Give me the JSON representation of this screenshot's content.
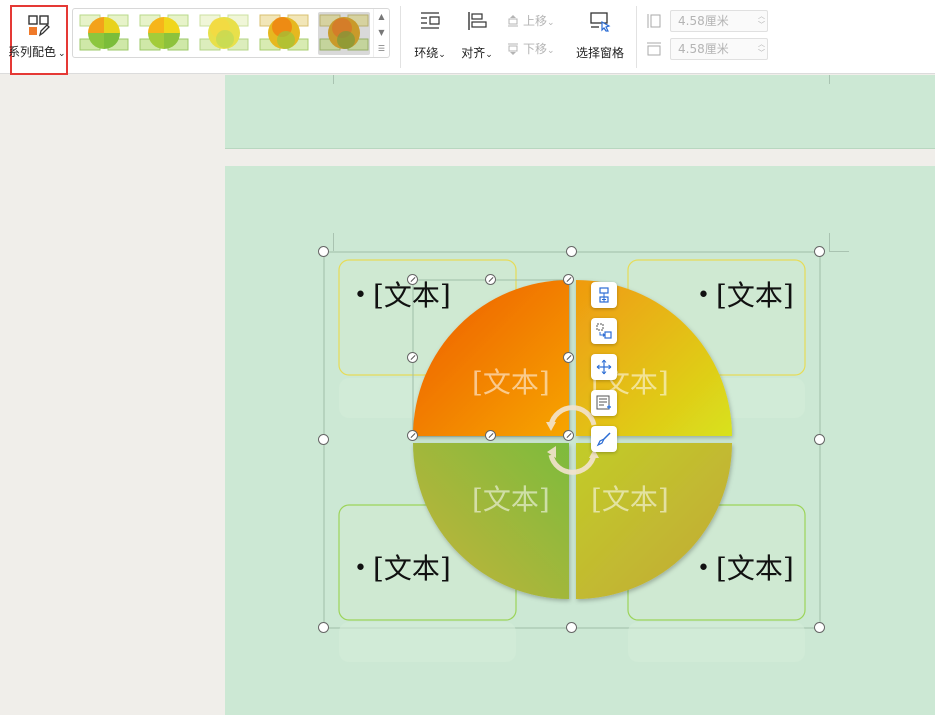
{
  "toolbar": {
    "series_color_label": "系列配色",
    "wrap_label": "环绕",
    "align_label": "对齐",
    "select_pane_label": "选择窗格",
    "move_up_label": "上移",
    "move_down_label": "下移",
    "height_value": "4.58厘米",
    "width_value": "4.58厘米"
  },
  "style_gallery": {
    "thumbnails": [
      "style-1",
      "style-2",
      "style-3",
      "style-4",
      "style-5"
    ],
    "selected": "style-5"
  },
  "diagram": {
    "corner_texts": [
      "[文本]",
      "[文本]",
      "[文本]",
      "[文本]"
    ],
    "bullet": "•",
    "pie_texts": [
      "[文本]",
      "[文本]",
      "[文本]",
      "[文本]"
    ]
  },
  "icons": [
    "series-color-icon",
    "wrap-icon",
    "align-icon",
    "move-up-icon",
    "move-down-icon",
    "selection-pane-icon",
    "height-icon",
    "width-icon",
    "rotate-icon",
    "add-shape-icon",
    "change-layout-icon",
    "arrange-icon",
    "text-pane-icon",
    "format-brush-icon"
  ],
  "colors": {
    "accent_red": "#e53935",
    "slide_bg": "#cce8d4",
    "orange": "#f06a00",
    "yellow": "#e2d81a",
    "green": "#7ab63a"
  }
}
